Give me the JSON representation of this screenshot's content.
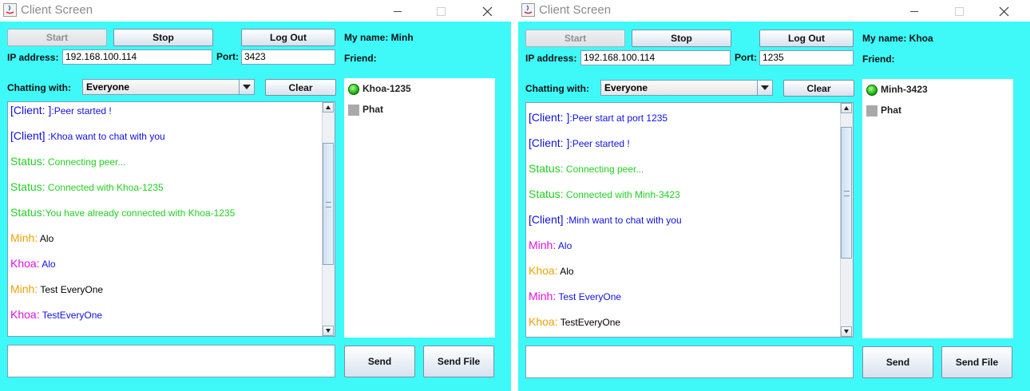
{
  "windows": [
    {
      "title": "Client Screen",
      "buttons": {
        "start": "Start",
        "stop": "Stop",
        "logout": "Log Out",
        "clear": "Clear",
        "send": "Send",
        "send_file": "Send File"
      },
      "my_name": "My name: Minh",
      "friend_label": "Friend:",
      "ip_label": "IP address:",
      "ip_value": "192.168.100.114",
      "port_label": "Port:",
      "port_value": "3423",
      "chatting_with_label": "Chatting with:",
      "chatting_with_value": "Everyone",
      "messages": [
        {
          "who": "[Client: ]",
          "text": ":Peer started !",
          "who_color": "#1010e0",
          "text_color": "#1010e0"
        },
        {
          "who": "[Client]",
          "text": " :Khoa want to chat with you",
          "who_color": "#1010e0",
          "text_color": "#1010e0"
        },
        {
          "who": "Status:",
          "text": " Connecting peer...",
          "who_color": "#22d022",
          "text_color": "#22d022"
        },
        {
          "who": "Status:",
          "text": " Connected with Khoa-1235",
          "who_color": "#22d022",
          "text_color": "#22d022"
        },
        {
          "who": "Status:",
          "text": "You have already connected with Khoa-1235",
          "who_color": "#22d022",
          "text_color": "#22d022"
        },
        {
          "who": "Minh:",
          "text": " Alo",
          "who_color": "#f0a000",
          "text_color": "#000000"
        },
        {
          "who": "Khoa:",
          "text": " Alo",
          "who_color": "#e010e0",
          "text_color": "#1010e0"
        },
        {
          "who": "Minh:",
          "text": " Test EveryOne",
          "who_color": "#f0a000",
          "text_color": "#000000"
        },
        {
          "who": "Khoa:",
          "text": " TestEveryOne",
          "who_color": "#e010e0",
          "text_color": "#1010e0"
        }
      ],
      "friends": [
        {
          "name": "Khoa-1235",
          "online": true
        },
        {
          "name": "Phat",
          "online": false
        }
      ],
      "message_input": ""
    },
    {
      "title": "Client Screen",
      "buttons": {
        "start": "Start",
        "stop": "Stop",
        "logout": "Log Out",
        "clear": "Clear",
        "send": "Send",
        "send_file": "Send File"
      },
      "my_name": "My name: Khoa",
      "friend_label": "Friend:",
      "ip_label": "IP address:",
      "ip_value": "192.168.100.114",
      "port_label": "Port:",
      "port_value": "1235",
      "chatting_with_label": "Chatting with:",
      "chatting_with_value": "Everyone",
      "messages": [
        {
          "who": "[Client: ]",
          "text": ":Peer start at port 1235",
          "who_color": "#1010e0",
          "text_color": "#1010e0"
        },
        {
          "who": "[Client: ]",
          "text": ":Peer started !",
          "who_color": "#1010e0",
          "text_color": "#1010e0"
        },
        {
          "who": "Status:",
          "text": " Connecting peer...",
          "who_color": "#22d022",
          "text_color": "#22d022"
        },
        {
          "who": "Status:",
          "text": " Connected with Minh-3423",
          "who_color": "#22d022",
          "text_color": "#22d022"
        },
        {
          "who": "[Client]",
          "text": " :Minh want to chat with you",
          "who_color": "#1010e0",
          "text_color": "#1010e0"
        },
        {
          "who": "Minh:",
          "text": " Alo",
          "who_color": "#e010e0",
          "text_color": "#1010e0"
        },
        {
          "who": "Khoa:",
          "text": " Alo",
          "who_color": "#f0a000",
          "text_color": "#000000"
        },
        {
          "who": "Minh:",
          "text": " Test EveryOne",
          "who_color": "#e010e0",
          "text_color": "#1010e0"
        },
        {
          "who": "Khoa:",
          "text": " TestEveryOne",
          "who_color": "#f0a000",
          "text_color": "#000000"
        }
      ],
      "friends": [
        {
          "name": "Minh-3423",
          "online": true
        },
        {
          "name": "Phat",
          "online": false
        }
      ],
      "message_input": ""
    }
  ]
}
